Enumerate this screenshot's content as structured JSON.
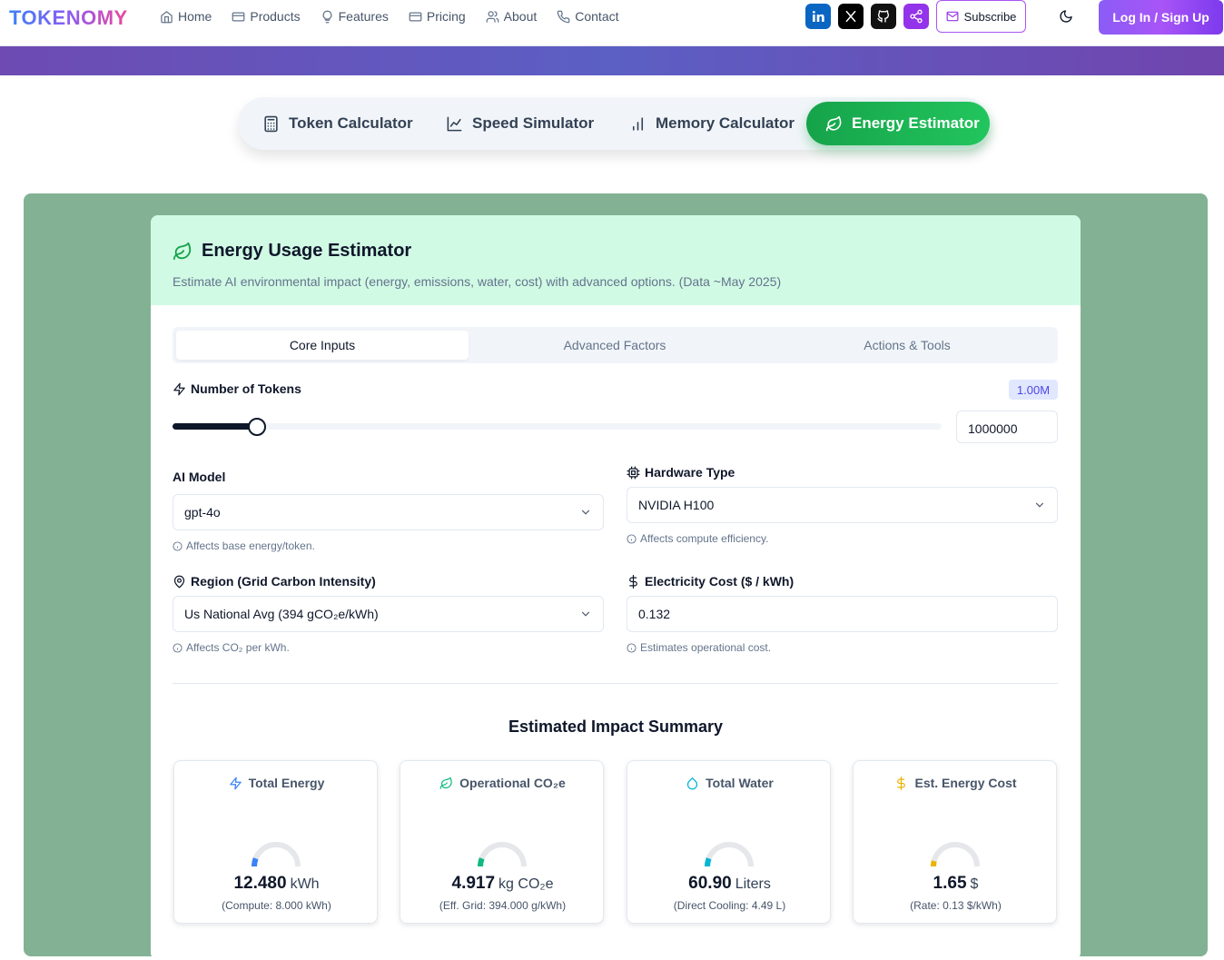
{
  "nav": {
    "logo": "TOKENOMY",
    "links": [
      {
        "label": "Home",
        "icon": "home-icon"
      },
      {
        "label": "Products",
        "icon": "products-icon"
      },
      {
        "label": "Features",
        "icon": "lightbulb-icon"
      },
      {
        "label": "Pricing",
        "icon": "card-icon"
      },
      {
        "label": "About",
        "icon": "users-icon"
      },
      {
        "label": "Contact",
        "icon": "phone-icon"
      }
    ],
    "social": [
      {
        "name": "linkedin-icon",
        "color": "#0a66c2"
      },
      {
        "name": "x-icon",
        "color": "#000000"
      },
      {
        "name": "github-icon",
        "color": "#111111"
      },
      {
        "name": "share-icon",
        "color": "#9333ea"
      }
    ],
    "subscribe": "Subscribe",
    "login": "Log In / Sign Up"
  },
  "tool_tabs": [
    {
      "label": "Token Calculator",
      "icon": "calculator-icon"
    },
    {
      "label": "Speed Simulator",
      "icon": "line-chart-icon"
    },
    {
      "label": "Memory Calculator",
      "icon": "bar-chart-icon"
    },
    {
      "label": "Energy Estimator",
      "icon": "leaf-icon",
      "active": true
    }
  ],
  "card": {
    "title": "Energy Usage Estimator",
    "subtitle": "Estimate AI environmental impact (energy, emissions, water, cost) with advanced options. (Data ~May 2025)"
  },
  "sub_tabs": [
    "Core Inputs",
    "Advanced Factors",
    "Actions & Tools"
  ],
  "tokens": {
    "label": "Number of Tokens",
    "badge": "1.00M",
    "value": "1000000",
    "slider_fraction": 0.11
  },
  "model": {
    "label": "AI Model",
    "value": "gpt-4o",
    "hint": "Affects base energy/token."
  },
  "hardware": {
    "label": "Hardware Type",
    "value": "NVIDIA H100",
    "hint": "Affects compute efficiency."
  },
  "region": {
    "label": "Region (Grid Carbon Intensity)",
    "value": "Us National Avg (394 gCO₂e/kWh)",
    "hint": "Affects CO₂ per kWh."
  },
  "electricity": {
    "label": "Electricity Cost ($ / kWh)",
    "value": "0.132",
    "hint": "Estimates operational cost."
  },
  "summary": {
    "title": "Estimated Impact Summary",
    "cards": [
      {
        "title": "Total Energy",
        "icon": "zap-icon",
        "color": "#3b82f6",
        "value": "12.480",
        "unit": "kWh",
        "sub": "(Compute: 8.000 kWh)",
        "gauge_fraction": 0.12
      },
      {
        "title": "Operational CO₂e",
        "icon": "leaf-icon",
        "color": "#10b981",
        "value": "4.917",
        "unit": "kg CO₂e",
        "sub": "(Eff. Grid: 394.000 g/kWh)",
        "gauge_fraction": 0.12
      },
      {
        "title": "Total Water",
        "icon": "droplet-icon",
        "color": "#06b6d4",
        "value": "60.90",
        "unit": "Liters",
        "sub": "(Direct Cooling: 4.49 L)",
        "gauge_fraction": 0.12
      },
      {
        "title": "Est. Energy Cost",
        "icon": "dollar-icon",
        "color": "#eab308",
        "value": "1.65",
        "unit": "$",
        "sub": "(Rate: 0.13 $/kWh)",
        "gauge_fraction": 0.08
      }
    ]
  }
}
